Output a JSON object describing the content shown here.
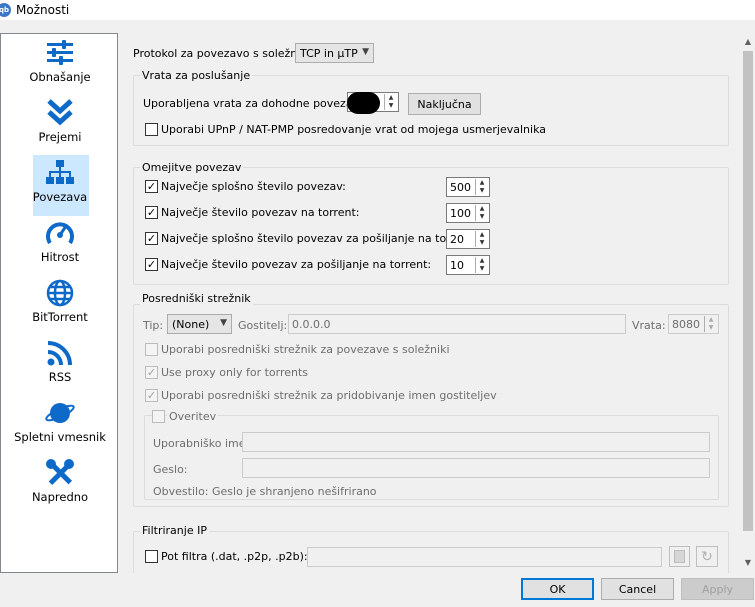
{
  "window": {
    "title": "Možnosti",
    "app_icon": "qb"
  },
  "sidebar": {
    "items": [
      {
        "label": "Obnašanje",
        "icon": "sliders-icon"
      },
      {
        "label": "Prejemi",
        "icon": "download-chevrons-icon"
      },
      {
        "label": "Povezava",
        "icon": "network-icon",
        "selected": true
      },
      {
        "label": "Hitrost",
        "icon": "speedometer-icon"
      },
      {
        "label": "BitTorrent",
        "icon": "globe-icon"
      },
      {
        "label": "RSS",
        "icon": "rss-icon"
      },
      {
        "label": "Spletni vmesnik",
        "icon": "planet-icon"
      },
      {
        "label": "Napredno",
        "icon": "tools-icon"
      }
    ]
  },
  "connection": {
    "protocol_label": "Protokol za povezavo s soležniki:",
    "protocol_value": "TCP in µTP"
  },
  "listening": {
    "title": "Vrata za poslušanje",
    "port_label": "Uporabljena vrata za dohodne povezave:",
    "random_button": "Naključna",
    "upnp_label": "Uporabi UPnP / NAT-PMP posredovanje vrat od mojega usmerjevalnika",
    "upnp_checked": false
  },
  "limits": {
    "title": "Omejitve povezav",
    "rows": [
      {
        "label": "Največje splošno število povezav:",
        "value": "500",
        "checked": true
      },
      {
        "label": "Največje število povezav na torrent:",
        "value": "100",
        "checked": true
      },
      {
        "label": "Največje splošno število povezav za pošiljanje na torrent:",
        "value": "20",
        "checked": true
      },
      {
        "label": "Največje število povezav za pošiljanje na torrent:",
        "value": "10",
        "checked": true
      }
    ]
  },
  "proxy": {
    "title": "Posredniški strežnik",
    "type_label": "Tip:",
    "type_value": "(None)",
    "host_label": "Gostitelj:",
    "host_value": "0.0.0.0",
    "port_label": "Vrata:",
    "port_value": "8080",
    "opt_peers": "Uporabi posredniški strežnik za povezave s soležniki",
    "opt_torrents_only": "Use proxy only for torrents",
    "opt_hostname": "Uporabi posredniški strežnik za pridobivanje imen gostiteljev",
    "auth_title": "Overitev",
    "username_label": "Uporabniško ime:",
    "password_label": "Geslo:",
    "notice": "Obvestilo: Geslo je shranjeno nešifrirano"
  },
  "ipfilter": {
    "title": "Filtriranje IP",
    "path_label": "Pot filtra (.dat, .p2p, .p2b):"
  },
  "buttons": {
    "ok": "OK",
    "cancel": "Cancel",
    "apply": "Apply"
  },
  "colors": {
    "selection": "#cce8ff",
    "icon_blue": "#0e6ac9",
    "default_button_border": "#0078d7"
  }
}
